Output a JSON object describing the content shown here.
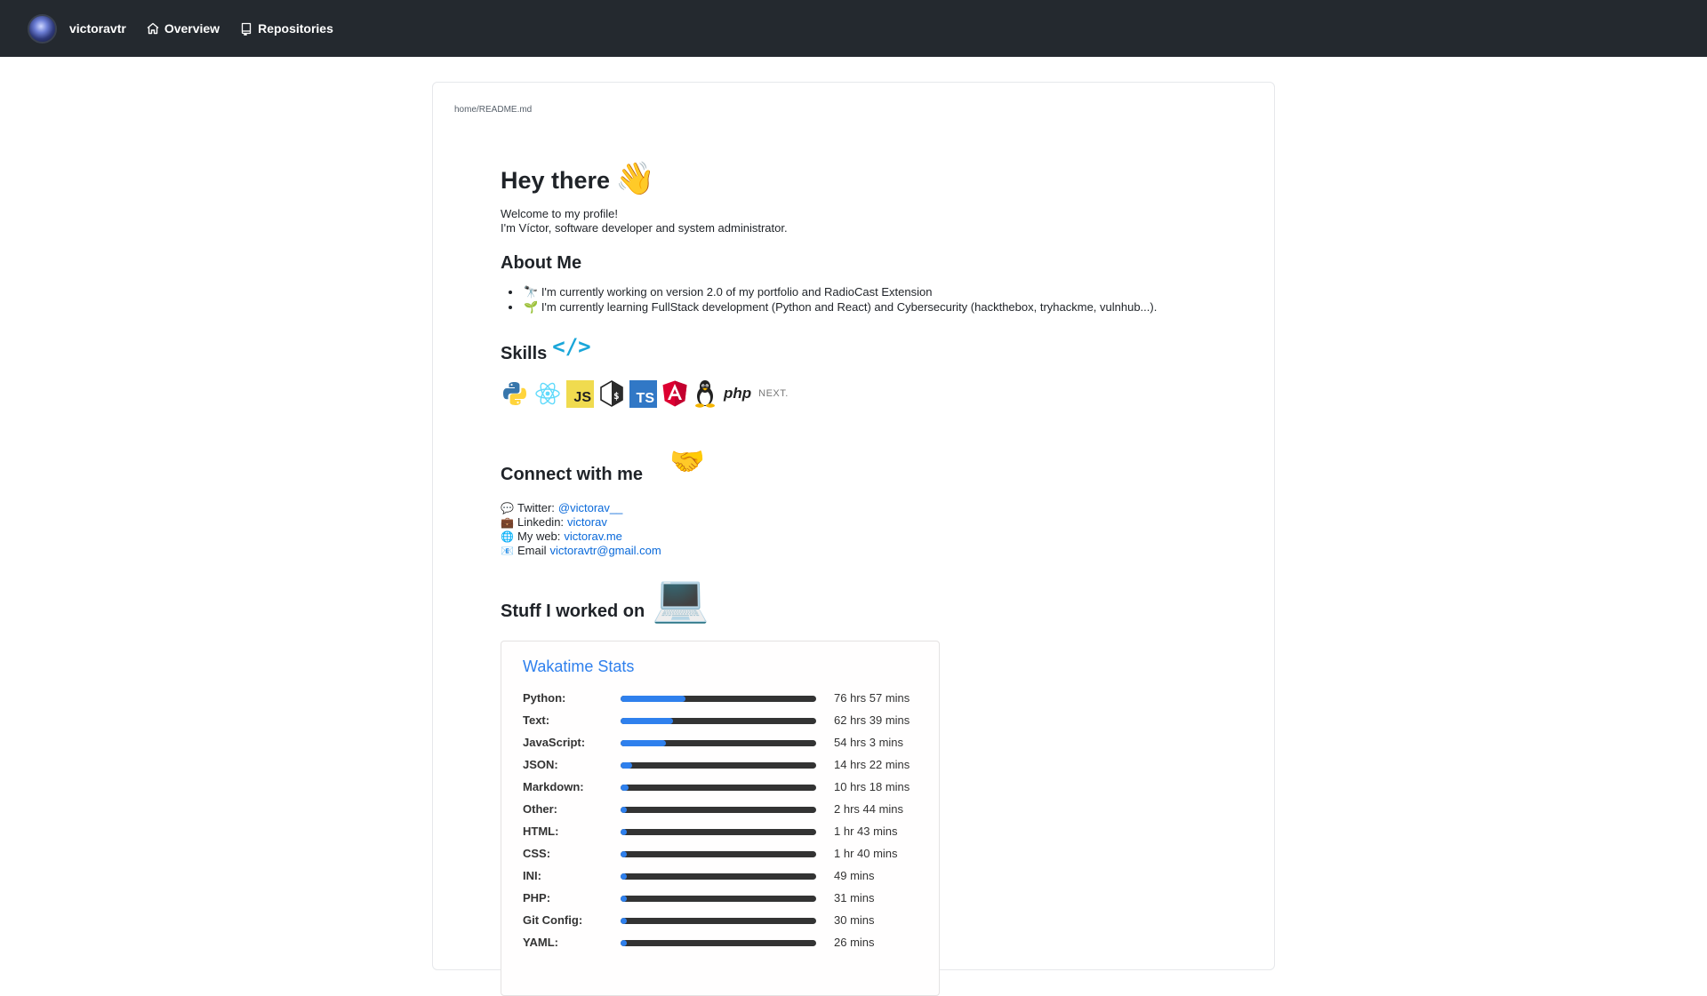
{
  "header": {
    "username": "victoravtr",
    "nav": [
      {
        "label": "Overview",
        "icon": "home-icon"
      },
      {
        "label": "Repositories",
        "icon": "book-icon"
      }
    ]
  },
  "readme": {
    "path": "home/README.md",
    "title": "Hey there",
    "title_emoji": "👋",
    "intro_line1": "Welcome to my profile!",
    "intro_line2": "I'm Víctor, software developer and system administrator.",
    "about_heading": "About Me",
    "about_items": [
      {
        "emoji": "🔭",
        "text": "I'm currently working on version 2.0 of my portfolio and RadioCast Extension"
      },
      {
        "emoji": "🌱",
        "text": "I'm currently learning FullStack development (Python and React) and Cybersecurity (hackthebox, tryhackme, vulnhub...)."
      }
    ],
    "skills_heading": "Skills",
    "skills_icon": "</>",
    "skills": [
      {
        "name": "python-icon"
      },
      {
        "name": "react-icon"
      },
      {
        "name": "javascript-icon",
        "text": "JS"
      },
      {
        "name": "bash-icon"
      },
      {
        "name": "typescript-icon",
        "text": "TS"
      },
      {
        "name": "angular-icon"
      },
      {
        "name": "linux-icon"
      },
      {
        "name": "php-icon",
        "text": "php"
      },
      {
        "name": "nextjs-icon",
        "text": "NEXT."
      }
    ],
    "connect_heading": "Connect with me",
    "connect_emoji": "🤝",
    "connect": [
      {
        "icon": "💬",
        "label": "Twitter:",
        "link": "@victorav__"
      },
      {
        "icon": "💼",
        "label": "Linkedin:",
        "link": "victorav"
      },
      {
        "icon": "🌐",
        "label": "My web:",
        "link": "victorav.me"
      },
      {
        "icon": "📧",
        "label": "Email",
        "link": "victoravtr@gmail.com"
      }
    ],
    "stuff_heading": "Stuff I worked on",
    "stuff_emoji": "💻"
  },
  "wakatime": {
    "title": "Wakatime Stats",
    "colors": {
      "fill": "#2f80ed",
      "track": "#333333"
    },
    "languages": [
      {
        "name": "Python:",
        "time": "76 hrs 57 mins",
        "percent": 33
      },
      {
        "name": "Text:",
        "time": "62 hrs 39 mins",
        "percent": 27
      },
      {
        "name": "JavaScript:",
        "time": "54 hrs 3 mins",
        "percent": 23
      },
      {
        "name": "JSON:",
        "time": "14 hrs 22 mins",
        "percent": 6
      },
      {
        "name": "Markdown:",
        "time": "10 hrs 18 mins",
        "percent": 4
      },
      {
        "name": "Other:",
        "time": "2 hrs 44 mins",
        "percent": 1
      },
      {
        "name": "HTML:",
        "time": "1 hr 43 mins",
        "percent": 1
      },
      {
        "name": "CSS:",
        "time": "1 hr 40 mins",
        "percent": 1
      },
      {
        "name": "INI:",
        "time": "49 mins",
        "percent": 0.5
      },
      {
        "name": "PHP:",
        "time": "31 mins",
        "percent": 0.3
      },
      {
        "name": "Git Config:",
        "time": "30 mins",
        "percent": 0.3
      },
      {
        "name": "YAML:",
        "time": "26 mins",
        "percent": 0.2
      }
    ]
  }
}
